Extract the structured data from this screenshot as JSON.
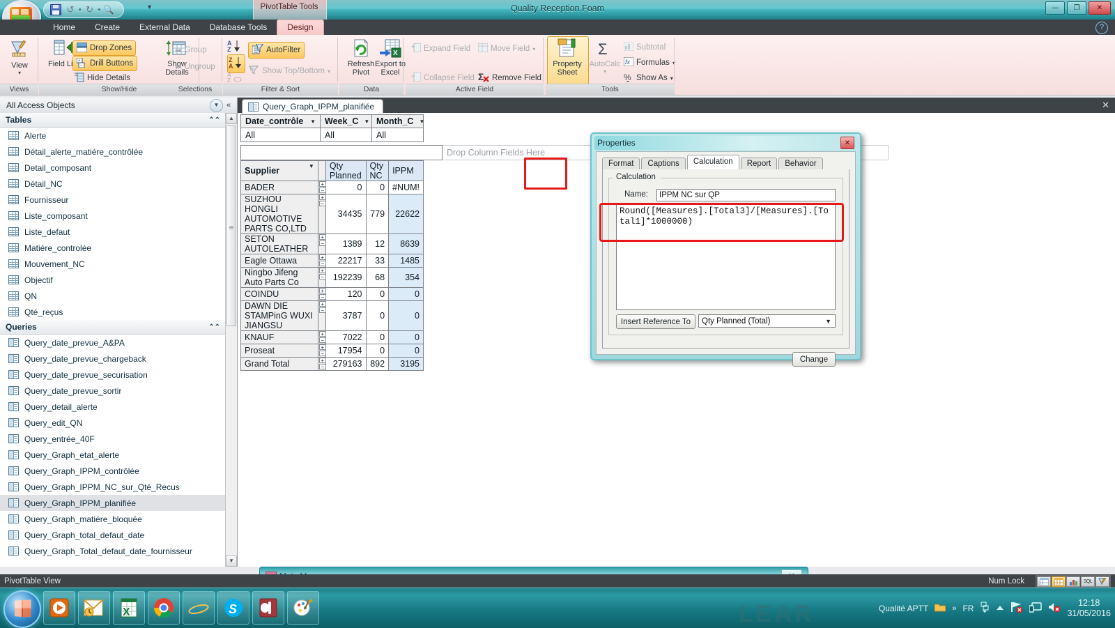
{
  "window": {
    "app_title": "Quality Reception Foam",
    "contextual_tab_group": "PivotTable Tools",
    "minimize": "—",
    "restore": "❐",
    "close": "✕",
    "help": "?"
  },
  "quick_access": {
    "save": "save-icon",
    "undo": "undo-icon",
    "redo": "redo-icon",
    "print_preview": "print-preview-icon",
    "customize": "customize-qat-icon"
  },
  "ribbon": {
    "tabs": [
      {
        "label": "Home",
        "selected": false
      },
      {
        "label": "Create",
        "selected": false
      },
      {
        "label": "External Data",
        "selected": false
      },
      {
        "label": "Database Tools",
        "selected": false
      },
      {
        "label": "Design",
        "selected": true
      }
    ],
    "groups": [
      {
        "name": "Views",
        "items": [
          {
            "label": "View",
            "type": "big",
            "dropdown": true
          }
        ]
      },
      {
        "name": "Show/Hide",
        "items": [
          {
            "label": "Field List",
            "type": "big"
          },
          {
            "label": "Drop Zones",
            "type": "small",
            "state": "active"
          },
          {
            "label": "Drill Buttons",
            "type": "small",
            "state": "active"
          },
          {
            "label": "Hide Details",
            "type": "small",
            "state": "normal"
          },
          {
            "label": "Show Details",
            "type": "big"
          }
        ]
      },
      {
        "name": "Selections",
        "items": [
          {
            "label": "Group",
            "type": "small",
            "state": "disabled"
          },
          {
            "label": "Ungroup",
            "type": "small",
            "state": "disabled"
          }
        ]
      },
      {
        "name": "Filter & Sort",
        "items": [
          {
            "label": "AutoFilter",
            "type": "small",
            "state": "active"
          },
          {
            "label": "Show Top/Bottom",
            "type": "small",
            "state": "disabled",
            "dropdown": true
          }
        ]
      },
      {
        "name": "Data",
        "items": [
          {
            "label": "Refresh Pivot",
            "type": "big"
          },
          {
            "label": "Export to Excel",
            "type": "big"
          }
        ]
      },
      {
        "name": "Active Field",
        "items": [
          {
            "label": "Expand Field",
            "type": "small",
            "state": "disabled"
          },
          {
            "label": "Move Field",
            "type": "small",
            "state": "disabled",
            "dropdown": true
          },
          {
            "label": "Collapse Field",
            "type": "small",
            "state": "disabled"
          },
          {
            "label": "Remove Field",
            "type": "small",
            "state": "normal"
          }
        ]
      },
      {
        "name": "Tools",
        "items": [
          {
            "label": "Property Sheet",
            "type": "big",
            "state": "active"
          },
          {
            "label": "AutoCalc",
            "type": "big",
            "state": "disabled",
            "dropdown": true
          },
          {
            "label": "Subtotal",
            "type": "small",
            "state": "disabled"
          },
          {
            "label": "Formulas",
            "type": "small",
            "state": "normal",
            "dropdown": true
          },
          {
            "label": "Show As",
            "type": "small",
            "state": "normal",
            "dropdown": true
          }
        ]
      }
    ]
  },
  "nav_pane": {
    "title": "All Access Objects",
    "dropdown_icon": "chevron-down-icon",
    "collapse_icon": "double-chevron-left-icon",
    "sections": [
      {
        "header": "Tables",
        "items": [
          "Alerte",
          "Détail_alerte_matiére_contrôlée",
          "Detail_composant",
          "Détail_NC",
          "Fournisseur",
          "Liste_composant",
          "Liste_defaut",
          "Matiére_controlée",
          "Mouvement_NC",
          "Objectif",
          "QN",
          "Qté_reçus"
        ]
      },
      {
        "header": "Queries",
        "items": [
          "Query_date_prevue_A&PA",
          "Query_date_prevue_chargeback",
          "Query_date_prevue_securisation",
          "Query_date_prevue_sortir",
          "Query_detail_alerte",
          "Query_edit_QN",
          "Query_entrée_40F",
          "Query_Graph_etat_alerte",
          "Query_Graph_IPPM_contrôlée",
          "Query_Graph_IPPM_NC_sur_Qté_Recus",
          "Query_Graph_IPPM_planifiée",
          "Query_Graph_matiére_bloquée",
          "Query_Graph_total_defaut_date",
          "Query_Graph_Total_defaut_date_fournisseur"
        ],
        "selected": "Query_Graph_IPPM_planifiée"
      }
    ]
  },
  "document": {
    "tab_label": "Query_Graph_IPPM_planifiée",
    "close_label": "✕",
    "pivot": {
      "filter_fields": [
        {
          "name": "Date_contrôle",
          "value": "All"
        },
        {
          "name": "Week_C",
          "value": "All"
        },
        {
          "name": "Month_C",
          "value": "All"
        }
      ],
      "drop_column_placeholder": "Drop Column Fields Here",
      "row_header": "Supplier",
      "measure_headers": [
        "Qty Planned",
        "Qty NC",
        "IPPM"
      ],
      "rows": [
        {
          "supplier": "BADER",
          "qty_planned": "0",
          "qty_nc": "0",
          "ippm": "#NUM!"
        },
        {
          "supplier": "SUZHOU HONGLI AUTOMOTIVE PARTS CO,LTD",
          "qty_planned": "34435",
          "qty_nc": "779",
          "ippm": "22622"
        },
        {
          "supplier": "SETON AUTOLEATHER",
          "qty_planned": "1389",
          "qty_nc": "12",
          "ippm": "8639"
        },
        {
          "supplier": "Eagle Ottawa",
          "qty_planned": "22217",
          "qty_nc": "33",
          "ippm": "1485"
        },
        {
          "supplier": "Ningbo Jifeng Auto Parts Co",
          "qty_planned": "192239",
          "qty_nc": "68",
          "ippm": "354"
        },
        {
          "supplier": "COINDU",
          "qty_planned": "120",
          "qty_nc": "0",
          "ippm": "0"
        },
        {
          "supplier": "DAWN DIE STAMPinG WUXI JIANGSU",
          "qty_planned": "3787",
          "qty_nc": "0",
          "ippm": "0"
        },
        {
          "supplier": "KNAUF",
          "qty_planned": "7022",
          "qty_nc": "0",
          "ippm": "0"
        },
        {
          "supplier": "Proseat",
          "qty_planned": "17954",
          "qty_nc": "0",
          "ippm": "0"
        },
        {
          "supplier": "Grand Total",
          "qty_planned": "279163",
          "qty_nc": "892",
          "ippm": "3195"
        }
      ]
    }
  },
  "properties_dialog": {
    "title": "Properties",
    "close_label": "✕",
    "tabs": [
      "Format",
      "Captions",
      "Calculation",
      "Report",
      "Behavior"
    ],
    "selected_tab": "Calculation",
    "section_legend": "Calculation",
    "name_label": "Name:",
    "name_value": "IPPM NC sur QP",
    "formula": "Round([Measures].[Total3]/[Measures].[Total1]*1000000)",
    "insert_reference_button": "Insert Reference To",
    "reference_select_value": "Qty Planned (Total)",
    "change_button": "Change"
  },
  "annotations": {
    "color": "#e61919",
    "boxes": [
      "ippm-column-header-and-num-error",
      "formula-textarea"
    ]
  },
  "main_menu_window": {
    "title": "Main Menu",
    "close_label": "✕"
  },
  "status_bar": {
    "view_mode": "PivotTable View",
    "num_lock": "Num Lock",
    "view_buttons": [
      "datasheet-view-icon",
      "pivottable-view-icon",
      "pivotchart-view-icon",
      "sql-view-icon",
      "design-view-icon"
    ],
    "active_view_button": "pivottable-view-icon"
  },
  "taskbar": {
    "start": "start-orb-icon",
    "items": [
      "windows-media-player-icon",
      "outlook-icon",
      "excel-icon",
      "chrome-icon",
      "internet-explorer-icon",
      "skype-icon",
      "access-icon",
      "paint-icon"
    ],
    "tray": {
      "user": "Qualité APTT",
      "folder_icon": "folder-icon",
      "overflow": "»",
      "language": "FR",
      "network_icon": "network-error-icon",
      "display_icon": "display-icon",
      "volume_icon": "volume-muted-icon",
      "time": "12:18",
      "date": "31/05/2016"
    }
  }
}
